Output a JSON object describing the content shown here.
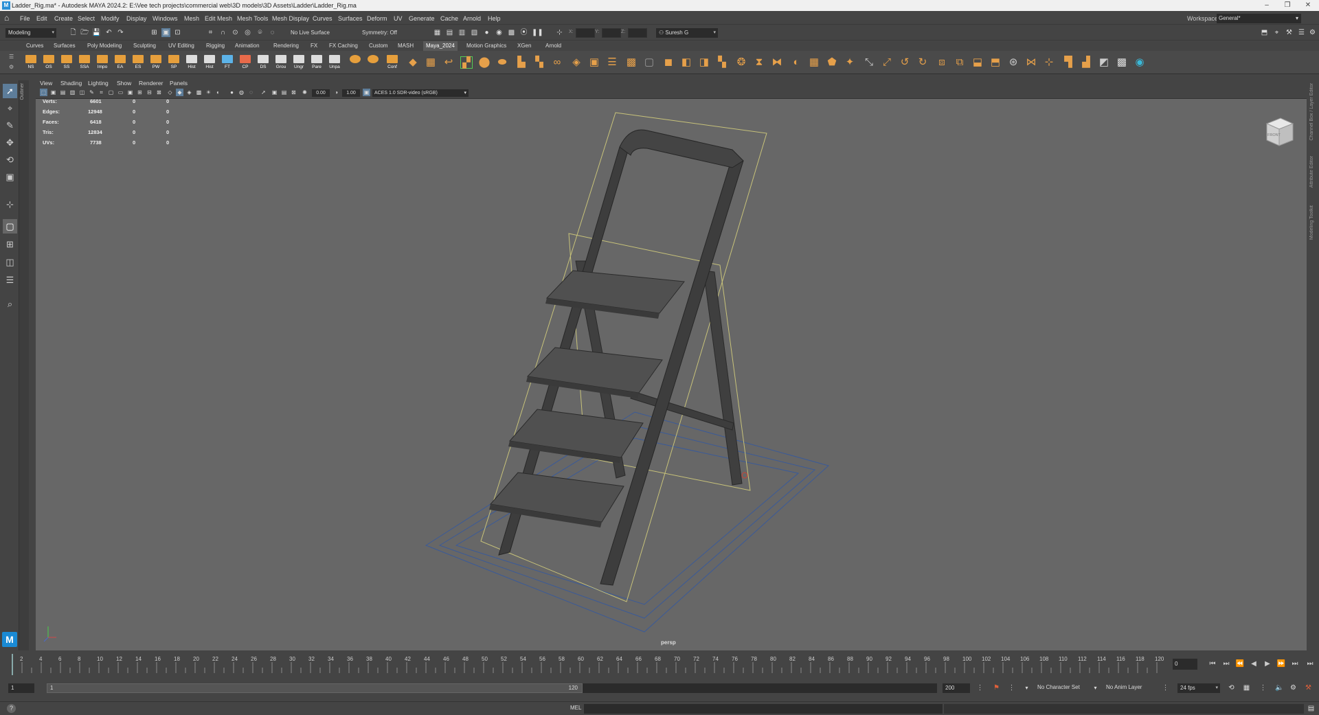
{
  "window": {
    "title": "Ladder_Rig.ma* - Autodesk MAYA 2024.2: E:\\Vee tech projects\\commercial web\\3D models\\3D Assets\\Ladder\\Ladder_Rig.ma",
    "app_icon": "M"
  },
  "menubar": {
    "items": [
      "File",
      "Edit",
      "Create",
      "Select",
      "Modify",
      "Display",
      "Windows",
      "Mesh",
      "Edit Mesh",
      "Mesh Tools",
      "Mesh Display",
      "Curves",
      "Surfaces",
      "Deform",
      "UV",
      "Generate",
      "Cache",
      "Arnold",
      "Help"
    ],
    "workspace_label": "Workspace:",
    "workspace_value": "General*"
  },
  "statusline": {
    "menuset": "Modeling",
    "live_surface": "No Live Surface",
    "symmetry": "Symmetry: Off",
    "x_label": "X:",
    "y_label": "Y:",
    "z_label": "Z:",
    "user": "Suresh G"
  },
  "shelf": {
    "tabs": [
      "Curves",
      "Surfaces",
      "Poly Modeling",
      "Sculpting",
      "UV Editing",
      "Rigging",
      "Animation",
      "Rendering",
      "FX",
      "FX Caching",
      "Custom",
      "MASH",
      "Maya_2024",
      "Motion Graphics",
      "XGen",
      "Arnold"
    ],
    "active_tab": "Maya_2024",
    "labeled_buttons": [
      "NS",
      "OS",
      "SS",
      "SSA",
      "Impo",
      "EA",
      "ES",
      "PW",
      "SP",
      "Hist",
      "Hist",
      "FT",
      "CP",
      "DS",
      "Grou",
      "Ungr",
      "Pare",
      "Unpa",
      "",
      "",
      "Conf"
    ]
  },
  "viewport": {
    "menu": [
      "View",
      "Shading",
      "Lighting",
      "Show",
      "Renderer",
      "Panels"
    ],
    "exposure": "0.00",
    "gamma": "1.00",
    "color_space": "ACES 1.0 SDR-video (sRGB)",
    "camera_label": "persp",
    "viewcube_face": "FRONT",
    "outliner_tab": "Outliner",
    "hud": [
      {
        "label": "Verts:",
        "a": "6601",
        "b": "0",
        "c": "0"
      },
      {
        "label": "Edges:",
        "a": "12948",
        "b": "0",
        "c": "0"
      },
      {
        "label": "Faces:",
        "a": "6418",
        "b": "0",
        "c": "0"
      },
      {
        "label": "Tris:",
        "a": "12834",
        "b": "0",
        "c": "0"
      },
      {
        "label": "UVs:",
        "a": "7738",
        "b": "0",
        "c": "0"
      }
    ]
  },
  "right_panel_tabs": [
    "Channel Box / Layer Editor",
    "Attribute Editor",
    "Modeling Toolkit"
  ],
  "timeslider": {
    "ticks": [
      "2",
      "4",
      "6",
      "8",
      "10",
      "12",
      "14",
      "16",
      "18",
      "20",
      "22",
      "24",
      "26",
      "28",
      "30",
      "32",
      "34",
      "36",
      "38",
      "40",
      "42",
      "44",
      "46",
      "48",
      "50",
      "52",
      "54",
      "56",
      "58",
      "60",
      "62",
      "64",
      "66",
      "68",
      "70",
      "72",
      "74",
      "76",
      "78",
      "80",
      "82",
      "84",
      "86",
      "88",
      "90",
      "92",
      "94",
      "96",
      "98",
      "100",
      "102",
      "104",
      "106",
      "108",
      "110",
      "112",
      "114",
      "116",
      "118",
      "120"
    ],
    "current_frame": "0"
  },
  "range": {
    "start": "1",
    "inner_start": "1",
    "inner_end": "120",
    "end": "200",
    "character_set": "No Character Set",
    "anim_layer": "No Anim Layer",
    "fps": "24 fps"
  },
  "cmdline": {
    "label": "MEL"
  }
}
